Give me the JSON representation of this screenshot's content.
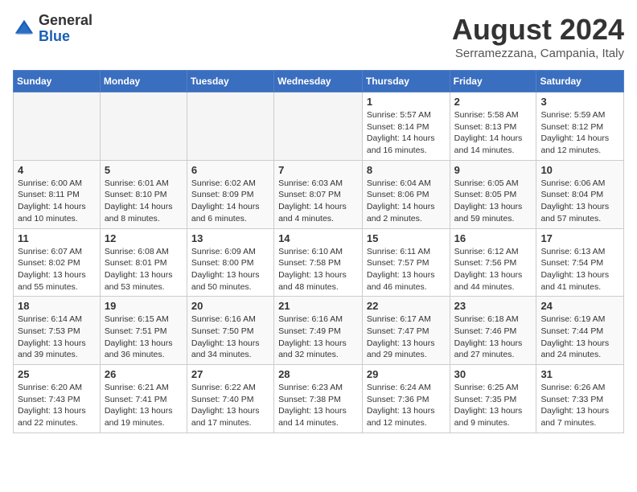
{
  "header": {
    "logo_general": "General",
    "logo_blue": "Blue",
    "title": "August 2024",
    "subtitle": "Serramezzana, Campania, Italy"
  },
  "days_of_week": [
    "Sunday",
    "Monday",
    "Tuesday",
    "Wednesday",
    "Thursday",
    "Friday",
    "Saturday"
  ],
  "weeks": [
    [
      {
        "day": "",
        "info": "",
        "empty": true
      },
      {
        "day": "",
        "info": "",
        "empty": true
      },
      {
        "day": "",
        "info": "",
        "empty": true
      },
      {
        "day": "",
        "info": "",
        "empty": true
      },
      {
        "day": "1",
        "info": "Sunrise: 5:57 AM\nSunset: 8:14 PM\nDaylight: 14 hours\nand 16 minutes."
      },
      {
        "day": "2",
        "info": "Sunrise: 5:58 AM\nSunset: 8:13 PM\nDaylight: 14 hours\nand 14 minutes."
      },
      {
        "day": "3",
        "info": "Sunrise: 5:59 AM\nSunset: 8:12 PM\nDaylight: 14 hours\nand 12 minutes."
      }
    ],
    [
      {
        "day": "4",
        "info": "Sunrise: 6:00 AM\nSunset: 8:11 PM\nDaylight: 14 hours\nand 10 minutes."
      },
      {
        "day": "5",
        "info": "Sunrise: 6:01 AM\nSunset: 8:10 PM\nDaylight: 14 hours\nand 8 minutes."
      },
      {
        "day": "6",
        "info": "Sunrise: 6:02 AM\nSunset: 8:09 PM\nDaylight: 14 hours\nand 6 minutes."
      },
      {
        "day": "7",
        "info": "Sunrise: 6:03 AM\nSunset: 8:07 PM\nDaylight: 14 hours\nand 4 minutes."
      },
      {
        "day": "8",
        "info": "Sunrise: 6:04 AM\nSunset: 8:06 PM\nDaylight: 14 hours\nand 2 minutes."
      },
      {
        "day": "9",
        "info": "Sunrise: 6:05 AM\nSunset: 8:05 PM\nDaylight: 13 hours\nand 59 minutes."
      },
      {
        "day": "10",
        "info": "Sunrise: 6:06 AM\nSunset: 8:04 PM\nDaylight: 13 hours\nand 57 minutes."
      }
    ],
    [
      {
        "day": "11",
        "info": "Sunrise: 6:07 AM\nSunset: 8:02 PM\nDaylight: 13 hours\nand 55 minutes."
      },
      {
        "day": "12",
        "info": "Sunrise: 6:08 AM\nSunset: 8:01 PM\nDaylight: 13 hours\nand 53 minutes."
      },
      {
        "day": "13",
        "info": "Sunrise: 6:09 AM\nSunset: 8:00 PM\nDaylight: 13 hours\nand 50 minutes."
      },
      {
        "day": "14",
        "info": "Sunrise: 6:10 AM\nSunset: 7:58 PM\nDaylight: 13 hours\nand 48 minutes."
      },
      {
        "day": "15",
        "info": "Sunrise: 6:11 AM\nSunset: 7:57 PM\nDaylight: 13 hours\nand 46 minutes."
      },
      {
        "day": "16",
        "info": "Sunrise: 6:12 AM\nSunset: 7:56 PM\nDaylight: 13 hours\nand 44 minutes."
      },
      {
        "day": "17",
        "info": "Sunrise: 6:13 AM\nSunset: 7:54 PM\nDaylight: 13 hours\nand 41 minutes."
      }
    ],
    [
      {
        "day": "18",
        "info": "Sunrise: 6:14 AM\nSunset: 7:53 PM\nDaylight: 13 hours\nand 39 minutes."
      },
      {
        "day": "19",
        "info": "Sunrise: 6:15 AM\nSunset: 7:51 PM\nDaylight: 13 hours\nand 36 minutes."
      },
      {
        "day": "20",
        "info": "Sunrise: 6:16 AM\nSunset: 7:50 PM\nDaylight: 13 hours\nand 34 minutes."
      },
      {
        "day": "21",
        "info": "Sunrise: 6:16 AM\nSunset: 7:49 PM\nDaylight: 13 hours\nand 32 minutes."
      },
      {
        "day": "22",
        "info": "Sunrise: 6:17 AM\nSunset: 7:47 PM\nDaylight: 13 hours\nand 29 minutes."
      },
      {
        "day": "23",
        "info": "Sunrise: 6:18 AM\nSunset: 7:46 PM\nDaylight: 13 hours\nand 27 minutes."
      },
      {
        "day": "24",
        "info": "Sunrise: 6:19 AM\nSunset: 7:44 PM\nDaylight: 13 hours\nand 24 minutes."
      }
    ],
    [
      {
        "day": "25",
        "info": "Sunrise: 6:20 AM\nSunset: 7:43 PM\nDaylight: 13 hours\nand 22 minutes."
      },
      {
        "day": "26",
        "info": "Sunrise: 6:21 AM\nSunset: 7:41 PM\nDaylight: 13 hours\nand 19 minutes."
      },
      {
        "day": "27",
        "info": "Sunrise: 6:22 AM\nSunset: 7:40 PM\nDaylight: 13 hours\nand 17 minutes."
      },
      {
        "day": "28",
        "info": "Sunrise: 6:23 AM\nSunset: 7:38 PM\nDaylight: 13 hours\nand 14 minutes."
      },
      {
        "day": "29",
        "info": "Sunrise: 6:24 AM\nSunset: 7:36 PM\nDaylight: 13 hours\nand 12 minutes."
      },
      {
        "day": "30",
        "info": "Sunrise: 6:25 AM\nSunset: 7:35 PM\nDaylight: 13 hours\nand 9 minutes."
      },
      {
        "day": "31",
        "info": "Sunrise: 6:26 AM\nSunset: 7:33 PM\nDaylight: 13 hours\nand 7 minutes."
      }
    ]
  ]
}
